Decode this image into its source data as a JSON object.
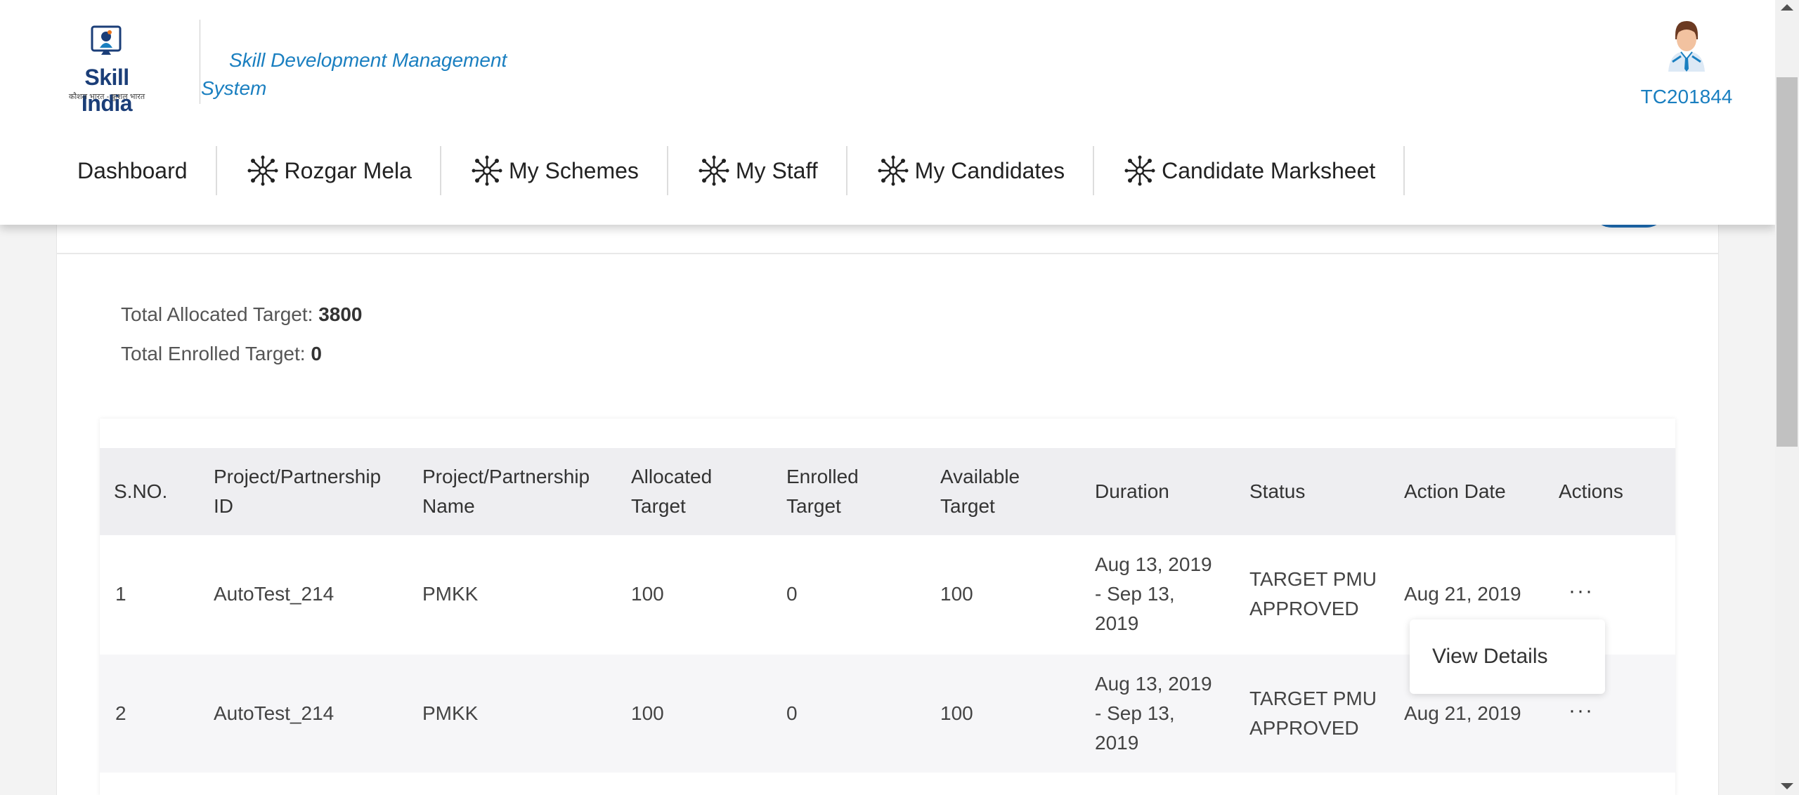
{
  "header": {
    "logo_text": "Skill India",
    "logo_tagline": "कौशल भारत - कुशल भारत",
    "app_title_line1": "Skill Development Management",
    "app_title_line2": "System",
    "user_id": "TC201844"
  },
  "nav": {
    "items": [
      {
        "label": "Dashboard",
        "icon": "none"
      },
      {
        "label": "Rozgar Mela",
        "icon": "network-icon"
      },
      {
        "label": "My Schemes",
        "icon": "network-icon"
      },
      {
        "label": "My Staff",
        "icon": "network-icon"
      },
      {
        "label": "My Candidates",
        "icon": "network-icon"
      },
      {
        "label": "Candidate Marksheet",
        "icon": "network-icon"
      }
    ]
  },
  "totals": {
    "allocated_label": "Total Allocated Target: ",
    "allocated_value": "3800",
    "enrolled_label": "Total Enrolled Target: ",
    "enrolled_value": "0"
  },
  "table": {
    "headers": [
      [
        "S.NO."
      ],
      [
        "Project/Partnership",
        "ID"
      ],
      [
        "Project/Partnership",
        "Name"
      ],
      [
        "Allocated",
        "Target"
      ],
      [
        "Enrolled",
        "Target"
      ],
      [
        "Available",
        "Target"
      ],
      [
        "Duration"
      ],
      [
        "Status"
      ],
      [
        "Action Date"
      ],
      [
        "Actions"
      ]
    ],
    "rows": [
      {
        "sno": "1",
        "id": "AutoTest_214",
        "name": "PMKK",
        "allocated": "100",
        "enrolled": "0",
        "available": "100",
        "duration": [
          "Aug 13, 2019",
          "- Sep 13,",
          "2019"
        ],
        "status": [
          "TARGET PMU",
          "APPROVED"
        ],
        "action_date": "Aug 21, 2019",
        "actions": "···"
      },
      {
        "sno": "2",
        "id": "AutoTest_214",
        "name": "PMKK",
        "allocated": "100",
        "enrolled": "0",
        "available": "100",
        "duration": [
          "Aug 13, 2019",
          "- Sep 13,",
          "2019"
        ],
        "status": [
          "TARGET PMU",
          "APPROVED"
        ],
        "action_date": "Aug 21, 2019",
        "actions": "···"
      }
    ]
  },
  "dropdown": {
    "item": "View Details"
  },
  "colors": {
    "accent": "#1a7fc0",
    "brand_dark": "#1b3e78",
    "header_row": "#eeeef1"
  }
}
